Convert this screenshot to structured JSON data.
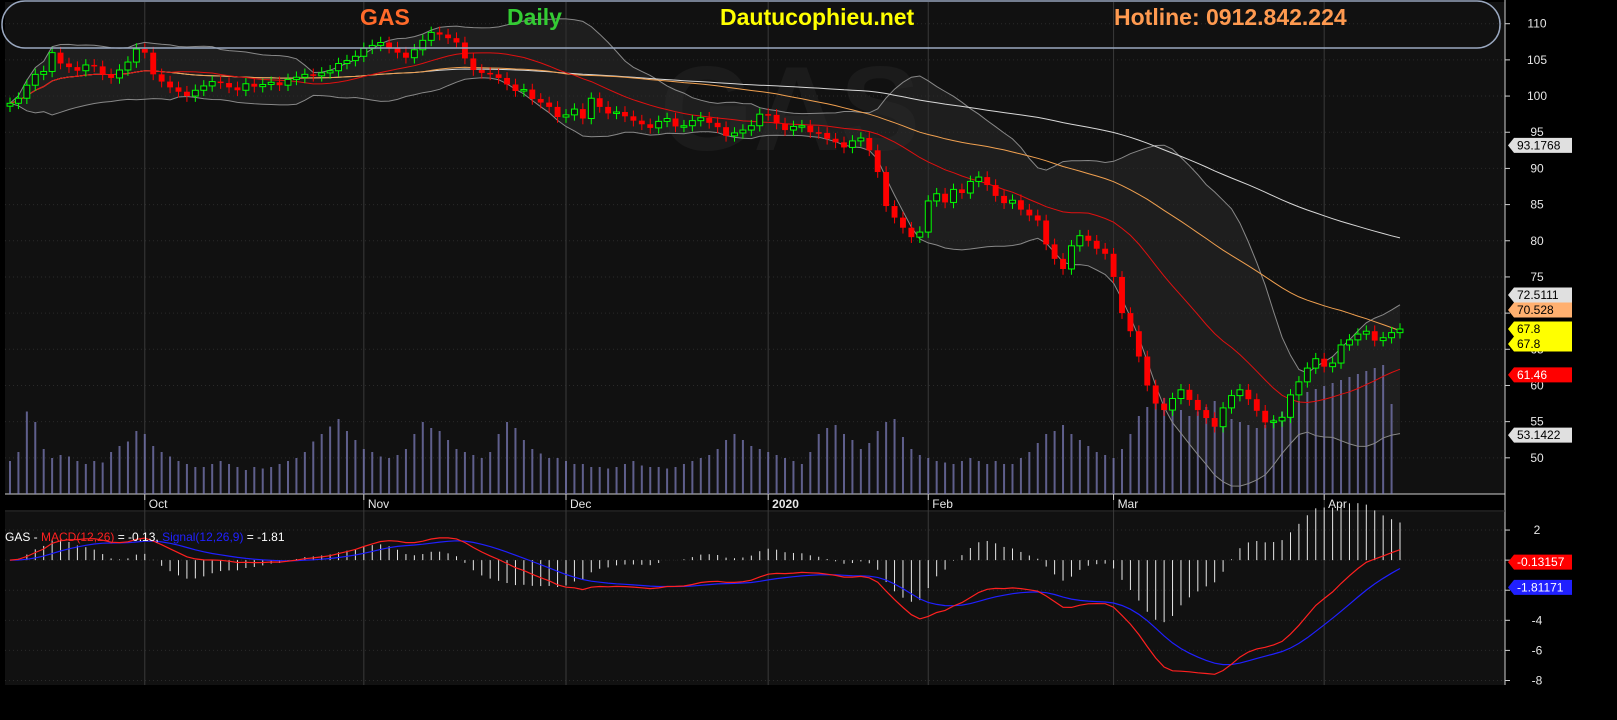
{
  "header": {
    "symbol": "GAS",
    "period": "Daily",
    "site": "Dautucophieu.net",
    "hotline": "Hotline: 0912.842.224",
    "watermark": "GAS"
  },
  "colors": {
    "background": "#0a0a0a",
    "panel": "#121212",
    "up_candle": "#00ff00",
    "down_candle": "#ff0000",
    "ma_red": "#e01010",
    "ma_orange": "#f0a050",
    "ma_white": "#d8d8d8",
    "band": "#888888",
    "volume": "#8080c0",
    "macd_line": "#ff2020",
    "signal_line": "#2020ff",
    "symbol_text": "#ff6a2a",
    "period_text": "#33cc33",
    "site_text": "#ffff00",
    "hotline_text": "#ff9a50"
  },
  "macd_info": {
    "symbol": "GAS",
    "dash": " - ",
    "macd_label": "MACD(12,26)",
    "macd_value": " = -0.13, ",
    "signal_label": "Signal(12,26,9)",
    "signal_value": " = -1.81"
  },
  "chart_data": [
    {
      "type": "candlestick",
      "series_name": "GAS",
      "y_ticks": [
        50,
        55,
        60,
        65,
        70,
        75,
        80,
        85,
        90,
        95,
        100,
        105,
        110
      ],
      "ylim": [
        45,
        113
      ],
      "x_tick_labels": [
        {
          "label": "Oct",
          "index": 16
        },
        {
          "label": "Nov",
          "index": 42
        },
        {
          "label": "Dec",
          "index": 66
        },
        {
          "label": "2020",
          "index": 90
        },
        {
          "label": "Feb",
          "index": 109
        },
        {
          "label": "Mar",
          "index": 131
        },
        {
          "label": "Apr",
          "index": 156
        }
      ],
      "close": [
        99,
        99.7,
        101.5,
        103,
        103.4,
        106,
        104.5,
        104,
        103.5,
        104.3,
        104.1,
        103,
        102.5,
        103.6,
        104.7,
        106.5,
        106,
        103,
        102,
        101.2,
        100.6,
        100,
        100.8,
        101.4,
        102,
        101.8,
        101.2,
        100.8,
        101.7,
        101.3,
        101.6,
        101.9,
        101.5,
        102.3,
        102.6,
        103,
        102.8,
        103.2,
        103.5,
        104.5,
        104.9,
        105.5,
        106.6,
        107,
        107.4,
        106.7,
        106,
        105.3,
        106.4,
        107.7,
        108.8,
        108.5,
        108,
        107.4,
        105.2,
        103.6,
        103.2,
        103,
        102.5,
        101.6,
        100.7,
        100.9,
        99.6,
        99.1,
        98.5,
        97.1,
        97.4,
        98.2,
        96.9,
        99.7,
        98.5,
        97.6,
        97.8,
        97.2,
        96.6,
        96.1,
        95.6,
        96.5,
        96.9,
        95.8,
        95.9,
        96.6,
        97,
        96.3,
        95.7,
        94.5,
        94.9,
        95.3,
        95.9,
        97.5,
        97.4,
        96.2,
        95.3,
        95.8,
        95.9,
        95,
        94.9,
        94.1,
        93.6,
        92.9,
        93.8,
        94.2,
        92.5,
        89.5,
        84.8,
        83.2,
        81.8,
        80.5,
        81.2,
        85.5,
        86.5,
        85.3,
        87.1,
        86.6,
        88.2,
        88.8,
        87.7,
        86.2,
        85.2,
        85.6,
        84.3,
        83.5,
        82.8,
        79.5,
        77.5,
        76.1,
        79.3,
        80.7,
        80,
        78.9,
        78.2,
        75,
        70,
        67.5,
        64,
        60,
        57.5,
        56.6,
        58.2,
        59.4,
        58,
        56.6,
        55.5,
        54.3,
        56.9,
        58.6,
        59.4,
        58.1,
        56.5,
        54.9,
        55.1,
        55.6,
        58.7,
        60.5,
        62.4,
        63.7,
        62.6,
        63.1,
        65.6,
        66.3,
        67.1,
        67.5,
        66.2,
        66.6,
        67.3,
        67.8
      ]
    },
    {
      "type": "line",
      "name": "moving averages and bands",
      "latest_values": {
        "upper_band": 72.5111,
        "ma_orange": 70.528,
        "close": 67.8,
        "ma_red": 61.46,
        "lower_band": 53.1422,
        "ma_white": 93.1768
      },
      "right_tags": [
        {
          "text": "93.1768",
          "value": 93.1768,
          "bg": "#e0e0e0",
          "fg": "#000000"
        },
        {
          "text": "72.5111",
          "value": 72.5111,
          "bg": "#e0e0e0",
          "fg": "#000000"
        },
        {
          "text": "70.528",
          "value": 70.528,
          "bg": "#ffb070",
          "fg": "#000000"
        },
        {
          "text": "67.8",
          "value": 67.8,
          "bg": "#ffff00",
          "fg": "#000000"
        },
        {
          "text": "67.8",
          "value": 67.8,
          "bg": "#ffff00",
          "fg": "#000000"
        },
        {
          "text": "61.46",
          "value": 61.46,
          "bg": "#ff0000",
          "fg": "#ffffff"
        },
        {
          "text": "53.1422",
          "value": 53.1422,
          "bg": "#e0e0e0",
          "fg": "#000000"
        }
      ]
    },
    {
      "type": "bar",
      "name": "volume",
      "values": [
        22,
        28,
        55,
        48,
        30,
        24,
        26,
        25,
        22,
        20,
        22,
        21,
        28,
        32,
        35,
        42,
        40,
        32,
        28,
        25,
        22,
        20,
        18,
        18,
        20,
        22,
        20,
        18,
        16,
        18,
        17,
        18,
        20,
        22,
        24,
        28,
        35,
        40,
        45,
        50,
        42,
        36,
        30,
        28,
        25,
        24,
        26,
        30,
        40,
        48,
        44,
        42,
        36,
        30,
        28,
        26,
        24,
        28,
        40,
        48,
        44,
        36,
        30,
        27,
        24,
        24,
        22,
        20,
        20,
        18,
        18,
        17,
        18,
        20,
        22,
        19,
        18,
        18,
        17,
        18,
        20,
        22,
        24,
        26,
        30,
        36,
        40,
        36,
        32,
        30,
        28,
        26,
        24,
        22,
        20,
        28,
        40,
        44,
        46,
        40,
        36,
        30,
        34,
        42,
        48,
        50,
        38,
        30,
        26,
        24,
        22,
        21,
        20,
        22,
        24,
        22,
        20,
        22,
        20,
        20,
        24,
        28,
        34,
        40,
        42,
        46,
        40,
        36,
        32,
        28,
        26,
        24,
        30,
        40,
        52,
        58,
        70,
        64,
        60,
        56,
        52,
        55,
        58,
        62,
        56,
        50,
        48,
        46,
        44,
        46,
        50,
        55,
        60,
        62,
        68,
        70,
        72,
        74,
        76,
        78,
        80,
        82,
        84,
        86,
        60
      ]
    },
    {
      "type": "line",
      "name": "MACD",
      "series": [
        {
          "name": "MACD(12,26)",
          "color": "#ff2020"
        },
        {
          "name": "Signal(12,26,9)",
          "color": "#2020ff"
        }
      ],
      "y_ticks": [
        2,
        0,
        -2,
        -4,
        -6,
        -8
      ],
      "ylim": [
        -8.3,
        3.2
      ],
      "macd_last": -0.13157,
      "signal_last": -1.81171,
      "right_tags": [
        {
          "text": "-0.13157",
          "value": -0.13157,
          "bg": "#ff0000",
          "fg": "#ffffff"
        },
        {
          "text": "-1.81171",
          "value": -1.81171,
          "bg": "#2020ff",
          "fg": "#ffffff"
        }
      ]
    }
  ]
}
